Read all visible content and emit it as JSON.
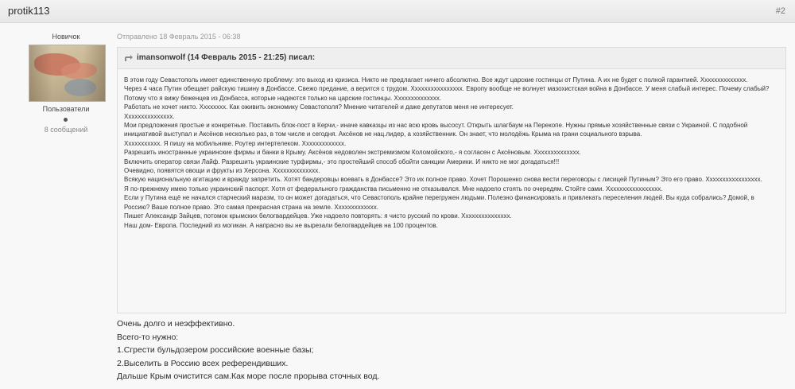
{
  "post": {
    "author": "protik113",
    "number": "#2",
    "date": "Отправлено 18 Февраль 2015 - 06:38"
  },
  "user": {
    "rank": "Новичок",
    "group": "Пользователи",
    "posts": "8 сообщений"
  },
  "quote": {
    "citation": "imansonwolf (14 Февраль 2015 - 21:25) писал:",
    "lines": [
      "В этом году Севастополь имеет единственную проблему: это выход из кризиса. Никто не предлагает ничего абсолютно. Все ждут царские гостинцы от Путина. А их не будет с полной гарантией. Хххххххххххххх.",
      "Через 4 часа Путин обещает райскую тишину в Донбассе. Свежо предание, а верится с трудом. Хххххххххххххххх. Европу вообще не волнует мазохистская война в Донбассе. У меня слабый интерес. Почему слабый? Потому что я вижу беженцев из Донбасса, которые надеются только на царские гостинцы. Хххххххххххххх.",
      "Работать не хочет никто. Хххххххх. Как оживить экономику Севастополя? Мнение читателей и даже депутатов меня не интересует.",
      "Ххххххххххххххх.",
      "Мои предложения простые и конкретные. Поставить блок-пост в Керчи,- иначе кавказцы из нас всю кровь высосут. Открыть шлагбаум на Перекопе. Нужны прямые хозяйственные связи с Украиной. С подобной инициативой выступал и Аксёнов несколько раз, в том числе и сегодня. Аксёнов не нац.лидер, а хозяйственник. Он знает, что молодёжь Крыма на грани социального взрыва.",
      "Ххххххххххх. Я пишу на мобильнике. Роутер интертелеком. Ххххххххххххх.",
      "Разрешить иностранные украинские фирмы и банки в Крыму. Аксёнов недоволен экстремизмом Коломойского,- я согласен с Аксёновым. Хххххххххххххх.",
      "Включить оператор связи Лайф. Разрешить украинские турфирмы,- это простейший способ обойти санкции Америки. И никто не мог догадаться!!!",
      "Очевидно, появятся овощи и фрукты из Херсона. Хххххххххххххх.",
      "Всякую национальную агитацию и вражду запретить. Хотят бандеровцы воевать в Донбассе? Это их полное право. Хочет Порошенко снова вести переговоры с лисицей Путиным? Это его право. Ххххххххххххххххх.",
      "Я по-прежнему имею только украинский паспорт. Хотя от федерального гражданства письменно не отказывался. Мне надоело стоять по очередям. Стойте сами. Ххххххххххххххххх.",
      "Если у Путина ещё не начался старческий маразм, то он может догадаться, что Севастополь крайне перегружен людьми. Полезно финансировать и привлекать переселения людей. Вы куда собрались? Домой, в Россию? Ваше полное право. Это самая прекрасная страна на земле. Ххххххххххххх.",
      "Пишет Александр Зайцев, потомок крымских белогвардейцев. Уже надоело повторять: я чисто русский по крови. Ххххххххххххххх.",
      "Наш дом- Европа. Последний из могикан. А напрасно вы не вырезали белогвардейцев на 100 процентов."
    ]
  },
  "reply": {
    "lines": [
      "Очень долго и неэффективно.",
      "Всего-то нужно:",
      "1.Сгрести бульдозером российские военные базы;",
      "2.Выселить в Россию всех референдивших.",
      "Дальше Крым очистится сам.Как море после прорыва сточных вод."
    ]
  },
  "colors": {
    "header_bg": "#ececec",
    "body_bg": "#f8f8f8",
    "quote_bg": "#f7f7f7",
    "quote_border": "#dcdcdc",
    "text": "#333333"
  },
  "icons": {
    "quote": "quote-arrow-icon",
    "online": "online-status-icon"
  }
}
